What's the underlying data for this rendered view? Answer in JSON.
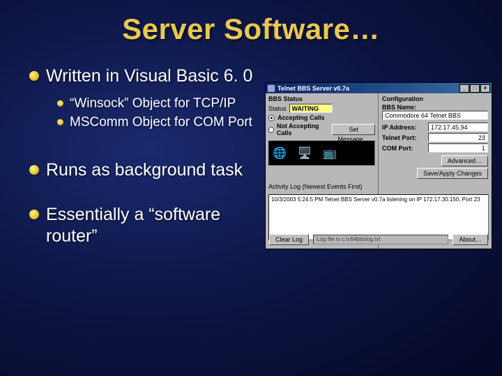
{
  "title": "Server Software…",
  "bullets": {
    "b1": "Written in Visual Basic 6. 0",
    "b1_sub1": "“Winsock” Object for TCP/IP",
    "b1_sub2": "MSComm Object for COM Port",
    "b2": "Runs as background task",
    "b3": "Essentially a “software router”"
  },
  "shot": {
    "title": "Telnet BBS Server v0.7a",
    "left": {
      "group": "BBS Status",
      "status_label": "Status",
      "status_value": "WAITING",
      "accepting": "Accepting Calls",
      "not_accepting": "Not Accepting Calls",
      "set_msg": "Set Message…"
    },
    "right": {
      "group": "Configuration",
      "bbs_name_label": "BBS Name:",
      "bbs_name_value": "Commodore 64 Telnet BBS",
      "ip_label": "IP Address:",
      "ip_value": "172.17.45.94",
      "telnet_label": "Telnet Port:",
      "telnet_value": "23",
      "com_label": "COM Port:",
      "com_value": "1",
      "advanced": "Advanced…",
      "save": "Save/Apply Changes"
    },
    "log_label": "Activity Log (Newest Events First)",
    "log_line": "10/3/2003 5:24:5 PM  Telnet BBS Server v0.7a listening on IP 172.17.30.150, Port 23",
    "clear_log": "Clear Log",
    "status_file": "Log file is c:\\c64bbslog.txt",
    "about": "About…"
  }
}
